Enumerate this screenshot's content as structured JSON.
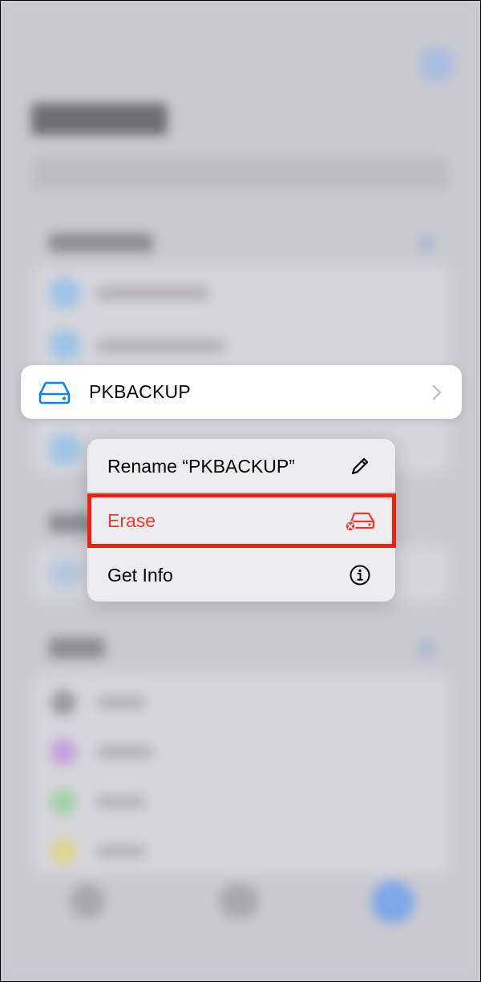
{
  "focused_item": {
    "label": "PKBACKUP",
    "icon": "external-drive-icon",
    "accessory_icon": "chevron-right-icon"
  },
  "context_menu": {
    "items": [
      {
        "label": "Rename “PKBACKUP”",
        "icon": "pencil-icon",
        "destructive": false
      },
      {
        "label": "Erase",
        "icon": "erase-drive-icon",
        "destructive": true
      },
      {
        "label": "Get Info",
        "icon": "info-circle-icon",
        "destructive": false
      }
    ]
  },
  "highlighted_item": "Erase",
  "colors": {
    "accent": "#0a84ff",
    "destructive": "#ee3b30",
    "highlight_box": "#f02010",
    "menu_background": "#ededf0"
  }
}
